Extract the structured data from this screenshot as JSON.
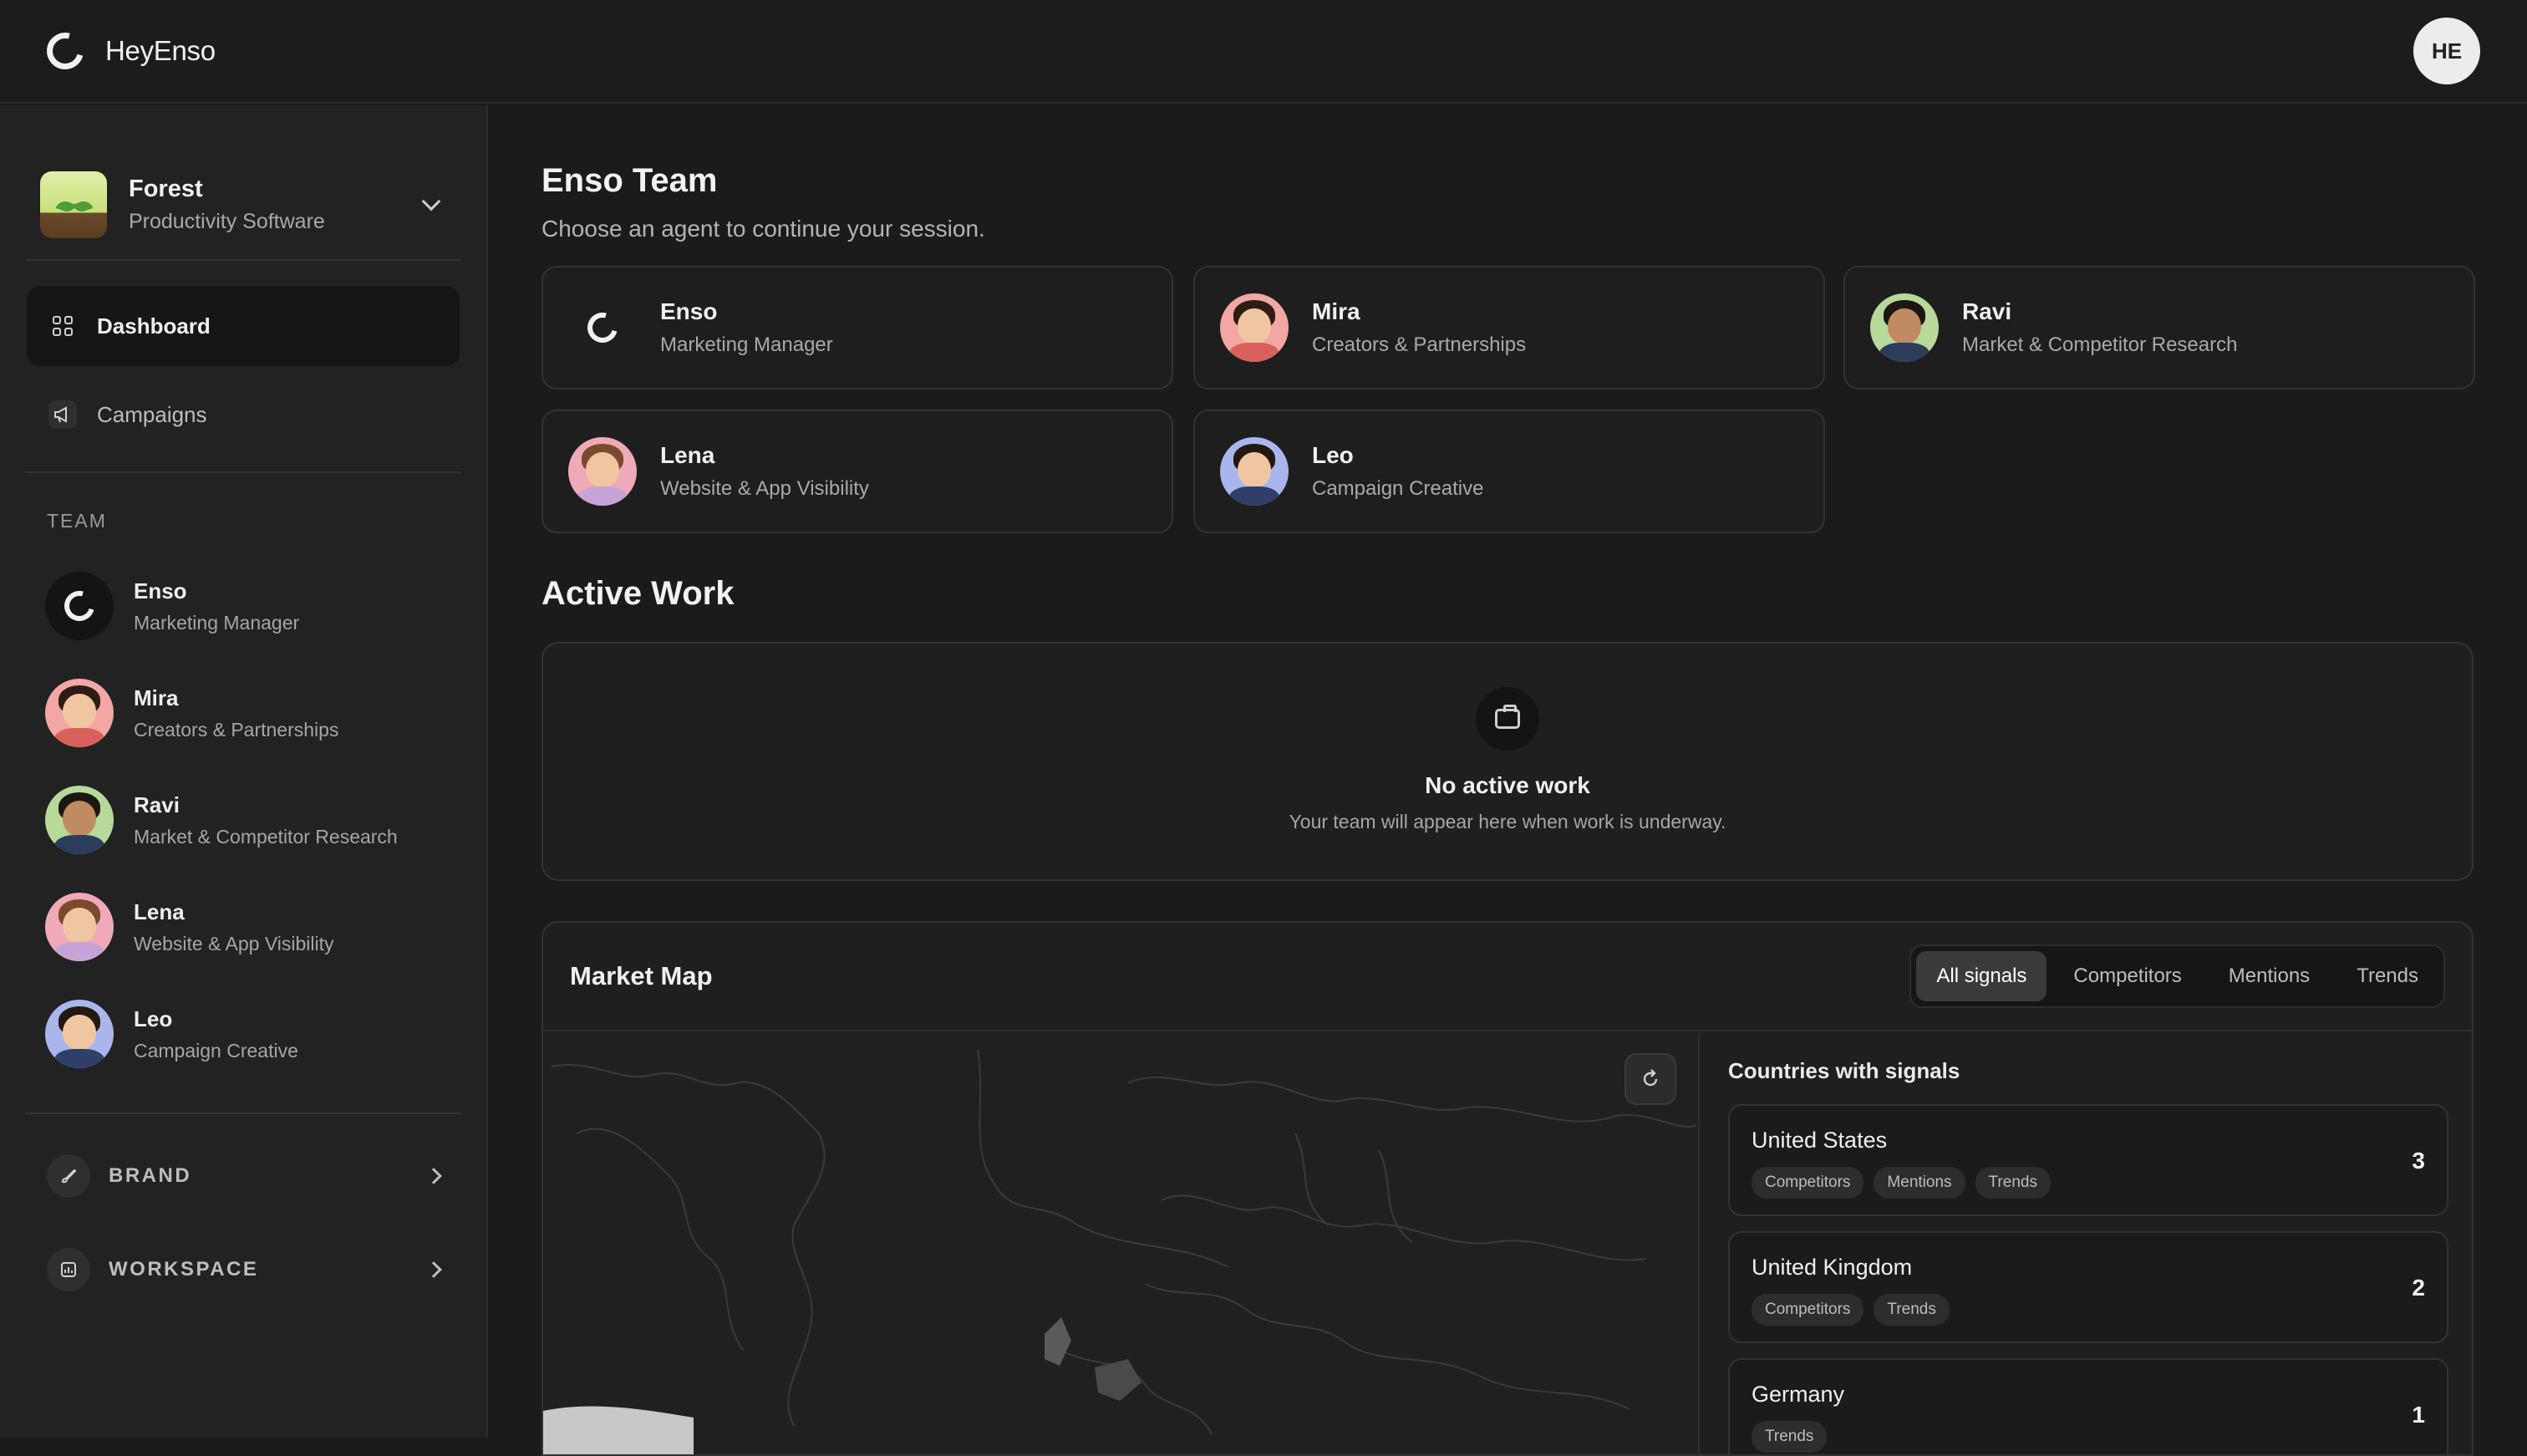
{
  "app": {
    "name": "HeyEnso",
    "user_initials": "HE"
  },
  "org": {
    "name": "Forest",
    "category": "Productivity Software"
  },
  "nav": [
    {
      "label": "Dashboard",
      "icon": "grid-icon",
      "active": true
    },
    {
      "label": "Campaigns",
      "icon": "megaphone-icon",
      "active": false
    }
  ],
  "team_section_label": "TEAM",
  "team": [
    {
      "name": "Enso",
      "role": "Marketing Manager"
    },
    {
      "name": "Mira",
      "role": "Creators & Partnerships"
    },
    {
      "name": "Ravi",
      "role": "Market & Competitor Research"
    },
    {
      "name": "Lena",
      "role": "Website & App Visibility"
    },
    {
      "name": "Leo",
      "role": "Campaign Creative"
    }
  ],
  "bottom_nav": [
    {
      "label": "BRAND",
      "icon": "brush-icon"
    },
    {
      "label": "WORKSPACE",
      "icon": "chart-icon"
    }
  ],
  "main": {
    "team_title": "Enso Team",
    "team_subtitle": "Choose an agent to continue your session.",
    "active_work_title": "Active Work",
    "empty_title": "No active work",
    "empty_subtitle": "Your team will appear here when work is underway."
  },
  "market_map": {
    "title": "Market Map",
    "filters": [
      "All signals",
      "Competitors",
      "Mentions",
      "Trends"
    ],
    "active_filter": "All signals",
    "countries_title": "Countries with signals",
    "countries": [
      {
        "name": "United States",
        "count": "3",
        "tags": [
          "Competitors",
          "Mentions",
          "Trends"
        ]
      },
      {
        "name": "United Kingdom",
        "count": "2",
        "tags": [
          "Competitors",
          "Trends"
        ]
      },
      {
        "name": "Germany",
        "count": "1",
        "tags": [
          "Trends"
        ]
      }
    ]
  },
  "colors": {
    "background": "#1b1b1b",
    "sidebar": "#222222",
    "accent": "#ececec"
  }
}
